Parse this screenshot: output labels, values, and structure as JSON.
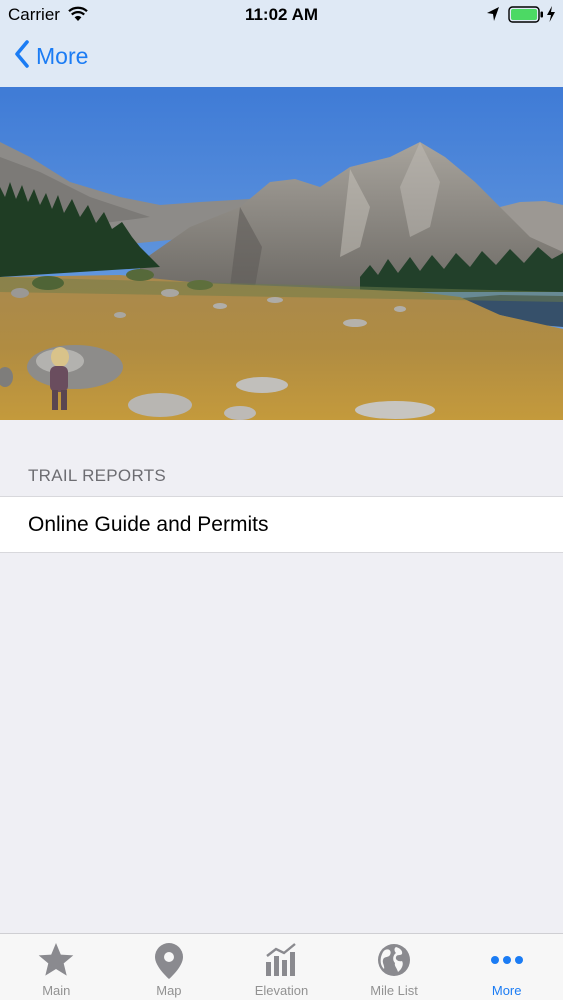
{
  "status_bar": {
    "carrier": "Carrier",
    "time": "11:02 AM",
    "icons": [
      "wifi-icon",
      "location-arrow-icon",
      "battery-icon",
      "charging-bolt-icon"
    ]
  },
  "nav": {
    "back_label": "More",
    "back_icon": "chevron-left-icon"
  },
  "colors": {
    "accent": "#1b7cf4",
    "bar_background": "#dfe9f5",
    "page_background": "#efeff4",
    "tab_inactive": "#929292"
  },
  "section": {
    "header": "TRAIL REPORTS",
    "rows": [
      {
        "label": "Online Guide and Permits"
      }
    ]
  },
  "tabbar": {
    "tabs": [
      {
        "label": "Main",
        "icon": "star-icon",
        "active": false
      },
      {
        "label": "Map",
        "icon": "map-pin-icon",
        "active": false
      },
      {
        "label": "Elevation",
        "icon": "bar-chart-icon",
        "active": false
      },
      {
        "label": "Mile List",
        "icon": "globe-icon",
        "active": false
      },
      {
        "label": "More",
        "icon": "more-dots-icon",
        "active": true
      }
    ]
  }
}
